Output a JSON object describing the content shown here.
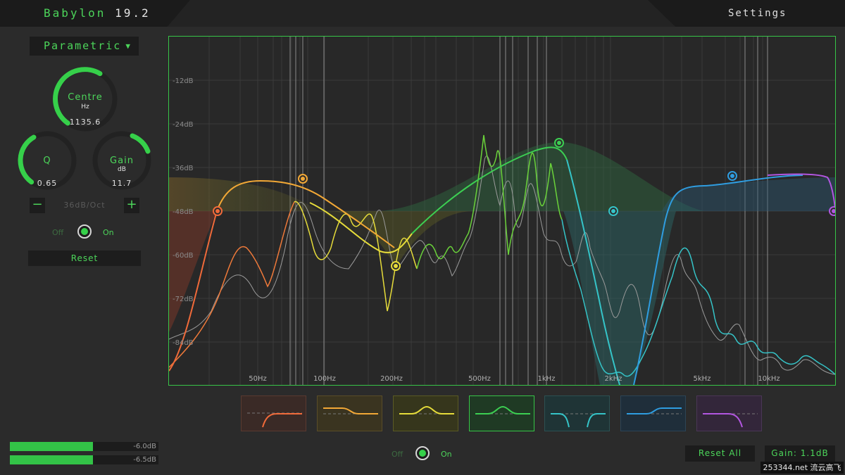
{
  "header": {
    "app_name": "Babylon",
    "version": "19.2",
    "settings_label": "Settings"
  },
  "left_panel": {
    "mode": "Parametric",
    "centre": {
      "label": "Centre",
      "unit": "Hz",
      "value": "1135.6"
    },
    "q": {
      "label": "Q",
      "value": "0.65"
    },
    "gain": {
      "label": "Gain",
      "unit": "dB",
      "value": "11.7"
    },
    "slope": {
      "minus": "−",
      "value": "36dB/Oct",
      "plus": "+"
    },
    "band_toggle": {
      "off": "Off",
      "on": "On"
    },
    "reset_label": "Reset"
  },
  "graph": {
    "db_labels": [
      "-12dB",
      "-24dB",
      "-36dB",
      "-48dB",
      "-60dB",
      "-72dB",
      "-84dB"
    ],
    "freq_labels": [
      "50Hz",
      "100Hz",
      "200Hz",
      "500Hz",
      "1kHz",
      "2kHz",
      "5kHz",
      "10kHz"
    ]
  },
  "bands": [
    {
      "name": "low-cut",
      "color": "#f06a3a"
    },
    {
      "name": "low-shelf",
      "color": "#f2a836"
    },
    {
      "name": "bell-1",
      "color": "#e6dc3a"
    },
    {
      "name": "bell-2",
      "color": "#3ccf52"
    },
    {
      "name": "notch",
      "color": "#35c4c8"
    },
    {
      "name": "high-shelf",
      "color": "#2f9de0"
    },
    {
      "name": "high-cut",
      "color": "#b256e0"
    }
  ],
  "footer": {
    "meter_left": "-6.0dB",
    "meter_right": "-6.5dB",
    "meter_left_level": 0.56,
    "meter_right_level": 0.56,
    "global_toggle": {
      "off": "Off",
      "on": "On"
    },
    "reset_all_label": "Reset All",
    "gain_readout": "Gain: 1.1dB"
  },
  "watermark": "253344.net 流云高飞"
}
